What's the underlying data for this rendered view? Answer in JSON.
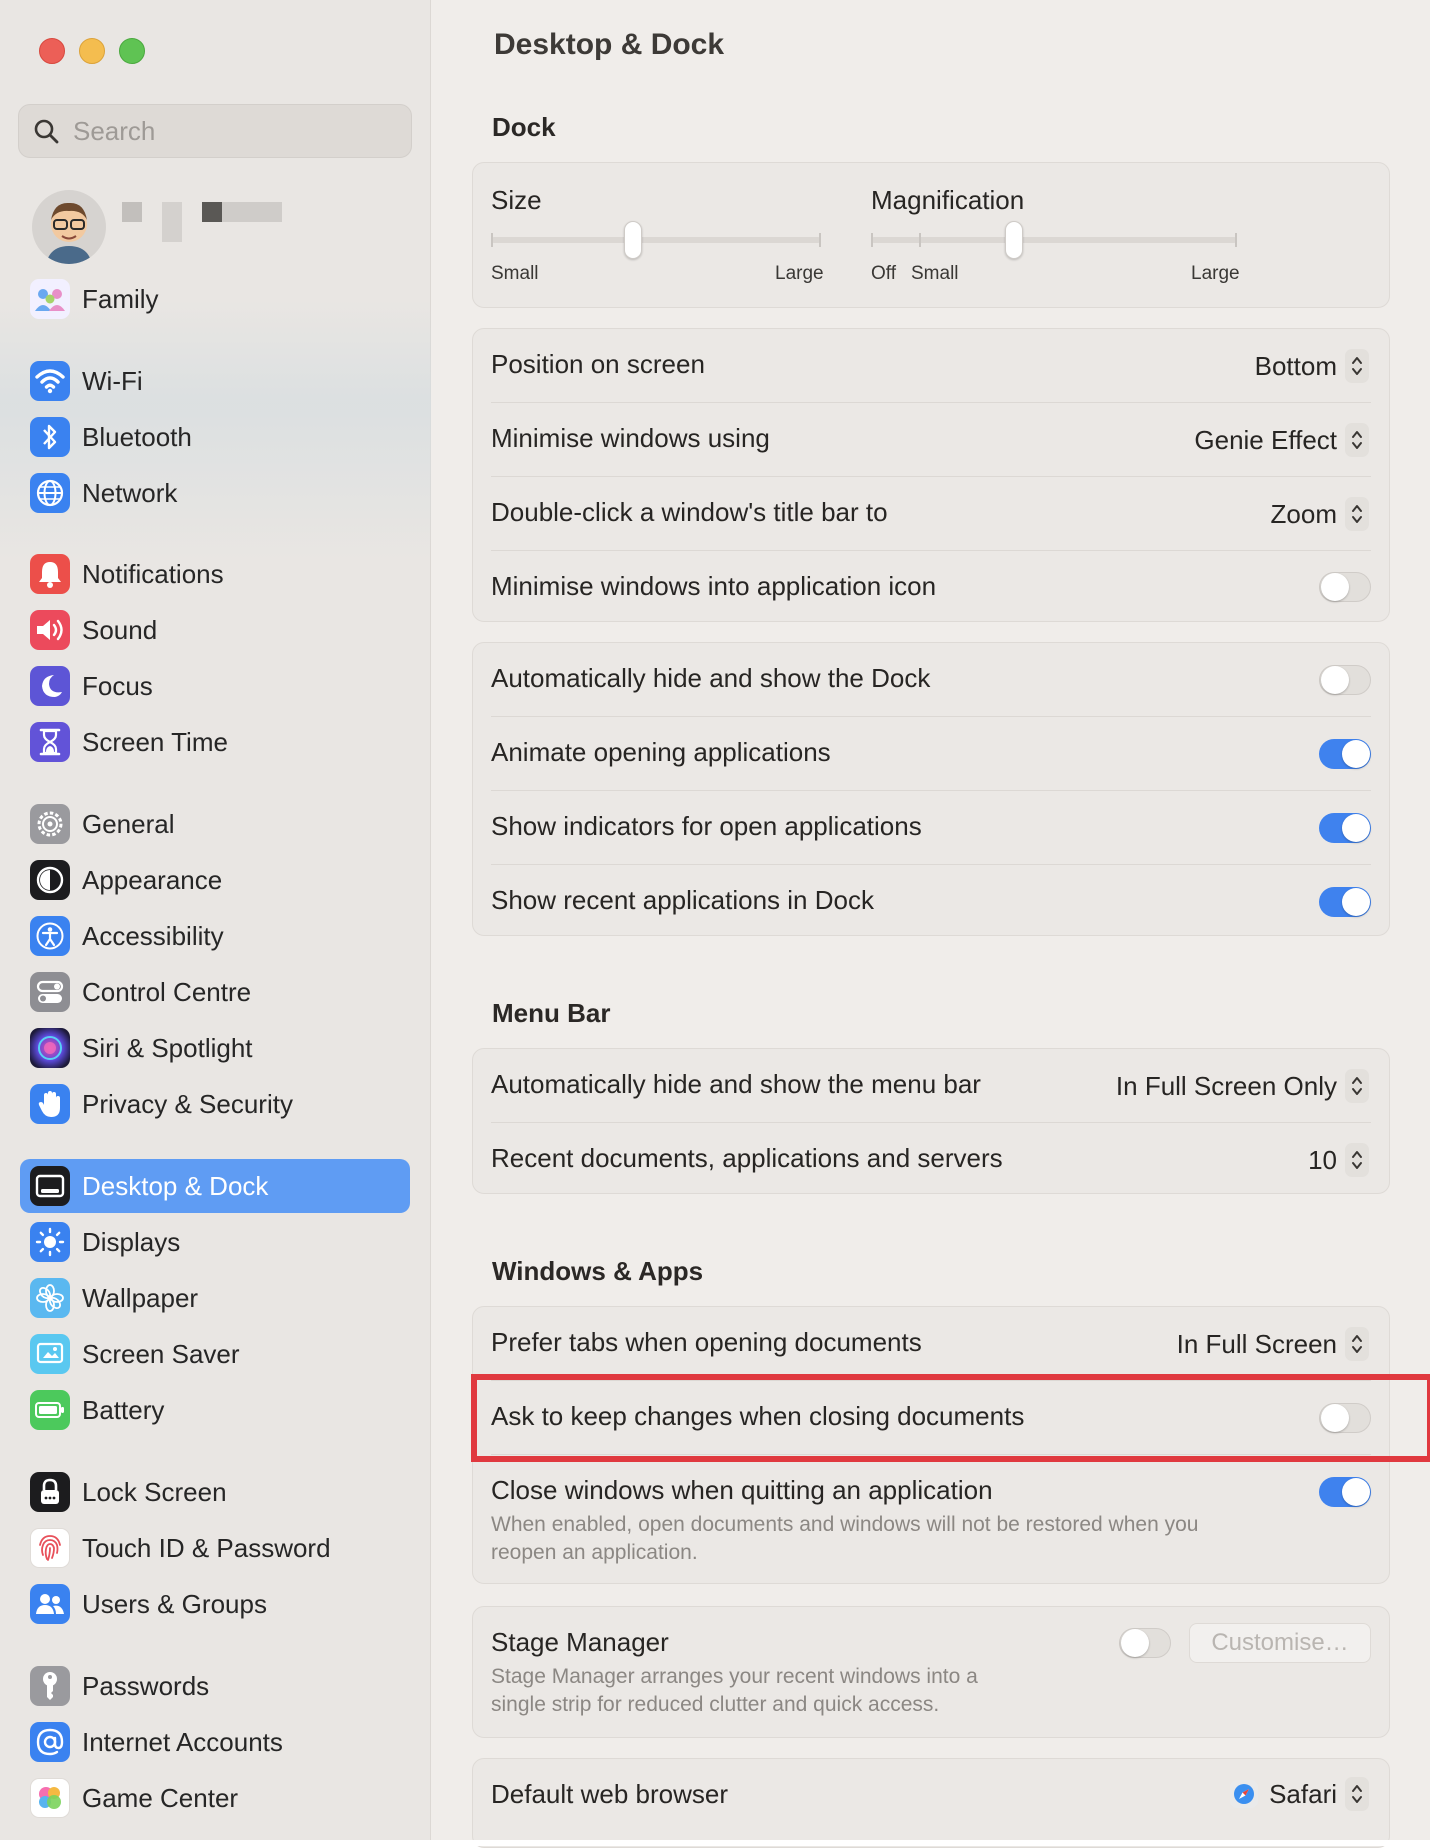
{
  "sidebar": {
    "search_placeholder": "Search",
    "items": [
      {
        "label": "Family",
        "icon": "family-icon",
        "color": "#e8e4ff"
      },
      {
        "label": "Wi-Fi",
        "icon": "wifi-icon",
        "color": "#3a82f0"
      },
      {
        "label": "Bluetooth",
        "icon": "bluetooth-icon",
        "color": "#3a82f0"
      },
      {
        "label": "Network",
        "icon": "network-globe-icon",
        "color": "#3a82f0"
      },
      {
        "label": "Notifications",
        "icon": "bell-icon",
        "color": "#ec4f4a"
      },
      {
        "label": "Sound",
        "icon": "speaker-icon",
        "color": "#ec4a5c"
      },
      {
        "label": "Focus",
        "icon": "moon-icon",
        "color": "#5d55d6"
      },
      {
        "label": "Screen Time",
        "icon": "hourglass-icon",
        "color": "#6253d8"
      },
      {
        "label": "General",
        "icon": "gear-icon",
        "color": "#8e8e93"
      },
      {
        "label": "Appearance",
        "icon": "appearance-icon",
        "color": "#1c1c1e"
      },
      {
        "label": "Accessibility",
        "icon": "accessibility-icon",
        "color": "#3a82f0"
      },
      {
        "label": "Control Centre",
        "icon": "control-centre-icon",
        "color": "#8e8e93"
      },
      {
        "label": "Siri & Spotlight",
        "icon": "siri-icon",
        "color": "#3b2a6b"
      },
      {
        "label": "Privacy & Security",
        "icon": "hand-icon",
        "color": "#3a82f0"
      },
      {
        "label": "Desktop & Dock",
        "icon": "desktop-dock-icon",
        "color": "#1c1c1e"
      },
      {
        "label": "Displays",
        "icon": "sun-icon",
        "color": "#3a82f0"
      },
      {
        "label": "Wallpaper",
        "icon": "wallpaper-flower-icon",
        "color": "#5ab8f0"
      },
      {
        "label": "Screen Saver",
        "icon": "screen-saver-icon",
        "color": "#5ac8f0"
      },
      {
        "label": "Battery",
        "icon": "battery-icon",
        "color": "#4cc95c"
      },
      {
        "label": "Lock Screen",
        "icon": "lock-icon",
        "color": "#1c1c1e"
      },
      {
        "label": "Touch ID & Password",
        "icon": "fingerprint-icon",
        "color": "#ffffff"
      },
      {
        "label": "Users & Groups",
        "icon": "users-icon",
        "color": "#3a82f0"
      },
      {
        "label": "Passwords",
        "icon": "key-icon",
        "color": "#8e8e93"
      },
      {
        "label": "Internet Accounts",
        "icon": "at-icon",
        "color": "#3a82f0"
      },
      {
        "label": "Game Center",
        "icon": "game-center-icon",
        "color": "#ffffff"
      }
    ]
  },
  "main": {
    "title": "Desktop & Dock",
    "dock": {
      "section_title": "Dock",
      "size_label": "Size",
      "size_min": "Small",
      "size_max": "Large",
      "size_value": 0.43,
      "magnification_label": "Magnification",
      "mag_off": "Off",
      "mag_small": "Small",
      "mag_large": "Large",
      "magnification_value": 0.39,
      "position_label": "Position on screen",
      "position_value": "Bottom",
      "minimise_label": "Minimise windows using",
      "minimise_value": "Genie Effect",
      "doubleclick_label": "Double-click a window's title bar to",
      "doubleclick_value": "Zoom",
      "minimise_into_icon_label": "Minimise windows into application icon",
      "minimise_into_icon_on": false,
      "autohide_label": "Automatically hide and show the Dock",
      "autohide_on": false,
      "animate_label": "Animate opening applications",
      "animate_on": true,
      "indicators_label": "Show indicators for open applications",
      "indicators_on": true,
      "recent_label": "Show recent applications in Dock",
      "recent_on": true
    },
    "menubar": {
      "section_title": "Menu Bar",
      "autohide_label": "Automatically hide and show the menu bar",
      "autohide_value": "In Full Screen Only",
      "recent_docs_label": "Recent documents, applications and servers",
      "recent_docs_value": "10"
    },
    "windows": {
      "section_title": "Windows & Apps",
      "prefer_tabs_label": "Prefer tabs when opening documents",
      "prefer_tabs_value": "In Full Screen",
      "ask_keep_label": "Ask to keep changes when closing documents",
      "ask_keep_on": false,
      "close_windows_label": "Close windows when quitting an application",
      "close_windows_on": true,
      "close_windows_desc_1": "When enabled, open documents and windows will not be restored when you",
      "close_windows_desc_2": "reopen an application.",
      "stage_manager_label": "Stage Manager",
      "stage_manager_on": false,
      "stage_manager_desc_1": "Stage Manager arranges your recent windows into a",
      "stage_manager_desc_2": "single strip for reduced clutter and quick access.",
      "customise_label": "Customise…",
      "browser_label": "Default web browser",
      "browser_value": "Safari"
    }
  },
  "colors": {
    "accent": "#3f82ee",
    "selected_sidebar": "#5f9cf3",
    "highlight_box": "#e0393f"
  }
}
